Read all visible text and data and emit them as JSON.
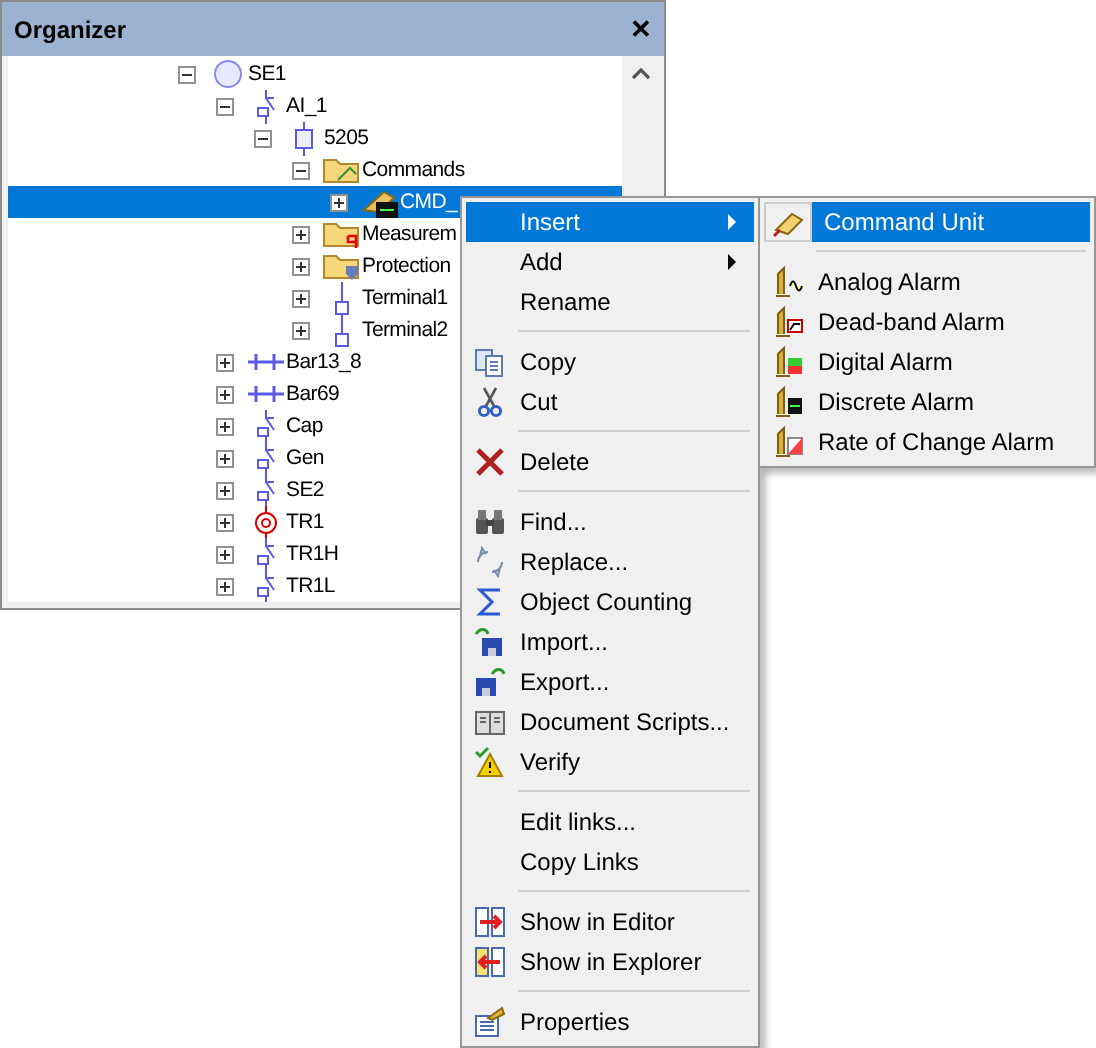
{
  "panel": {
    "title": "Organizer",
    "close": "✕"
  },
  "tree": [
    {
      "label": "SE1",
      "kind": "station",
      "expanded": true,
      "selected": false,
      "children": [
        {
          "label": "AI_1",
          "kind": "bay",
          "expanded": true,
          "selected": false,
          "children": [
            {
              "label": "5205",
              "kind": "node",
              "expanded": true,
              "selected": false,
              "children": [
                {
                  "label": "Commands",
                  "kind": "folder",
                  "expanded": true,
                  "selected": false,
                  "children": [
                    {
                      "label": "CMD_",
                      "kind": "command",
                      "expanded": false,
                      "selected": true
                    }
                  ]
                },
                {
                  "label": "Measurem",
                  "kind": "measure-folder",
                  "expanded": false,
                  "selected": false
                },
                {
                  "label": "Protection",
                  "kind": "protect-folder",
                  "expanded": false,
                  "selected": false
                },
                {
                  "label": "Terminal1",
                  "kind": "terminal",
                  "expanded": false,
                  "selected": false
                },
                {
                  "label": "Terminal2",
                  "kind": "terminal",
                  "expanded": false,
                  "selected": false
                }
              ]
            }
          ]
        },
        {
          "label": "Bar13_8",
          "kind": "busbar",
          "expanded": false,
          "selected": false
        },
        {
          "label": "Bar69",
          "kind": "busbar",
          "expanded": false,
          "selected": false
        },
        {
          "label": "Cap",
          "kind": "bay",
          "expanded": false,
          "selected": false
        },
        {
          "label": "Gen",
          "kind": "bay",
          "expanded": false,
          "selected": false
        },
        {
          "label": "SE2",
          "kind": "bay",
          "expanded": false,
          "selected": false
        },
        {
          "label": "TR1",
          "kind": "transformer",
          "expanded": false,
          "selected": false
        },
        {
          "label": "TR1H",
          "kind": "bay",
          "expanded": false,
          "selected": false
        },
        {
          "label": "TR1L",
          "kind": "bay",
          "expanded": false,
          "selected": false
        }
      ]
    }
  ],
  "context_menu": {
    "groups": [
      [
        {
          "label": "Insert",
          "kind": "plain",
          "submenu": true,
          "selected": true
        },
        {
          "label": "Add",
          "kind": "plain",
          "submenu": true,
          "selected": false
        },
        {
          "label": "Rename",
          "kind": "plain",
          "submenu": false,
          "selected": false
        }
      ],
      [
        {
          "label": "Copy",
          "kind": "copy",
          "submenu": false,
          "selected": false
        },
        {
          "label": "Cut",
          "kind": "cut",
          "submenu": false,
          "selected": false
        }
      ],
      [
        {
          "label": "Delete",
          "kind": "delete",
          "submenu": false,
          "selected": false
        }
      ],
      [
        {
          "label": "Find...",
          "kind": "find",
          "submenu": false,
          "selected": false
        },
        {
          "label": "Replace...",
          "kind": "replace",
          "submenu": false,
          "selected": false
        },
        {
          "label": "Object Counting",
          "kind": "sum",
          "submenu": false,
          "selected": false
        },
        {
          "label": "Import...",
          "kind": "import",
          "submenu": false,
          "selected": false
        },
        {
          "label": "Export...",
          "kind": "export",
          "submenu": false,
          "selected": false
        },
        {
          "label": "Document Scripts...",
          "kind": "book",
          "submenu": false,
          "selected": false
        },
        {
          "label": "Verify",
          "kind": "verify",
          "submenu": false,
          "selected": false
        }
      ],
      [
        {
          "label": "Edit links...",
          "kind": "plain",
          "submenu": false,
          "selected": false
        },
        {
          "label": "Copy Links",
          "kind": "plain",
          "submenu": false,
          "selected": false
        }
      ],
      [
        {
          "label": "Show in Editor",
          "kind": "show-editor",
          "submenu": false,
          "selected": false
        },
        {
          "label": "Show in Explorer",
          "kind": "show-explorer",
          "submenu": false,
          "selected": false
        }
      ],
      [
        {
          "label": "Properties",
          "kind": "properties",
          "submenu": false,
          "selected": false
        }
      ]
    ]
  },
  "submenu": {
    "groups": [
      [
        {
          "label": "Command Unit",
          "kind": "command",
          "selected": true
        }
      ],
      [
        {
          "label": "Analog Alarm",
          "kind": "analog",
          "selected": false
        },
        {
          "label": "Dead-band Alarm",
          "kind": "deadband",
          "selected": false
        },
        {
          "label": "Digital Alarm",
          "kind": "digital",
          "selected": false
        },
        {
          "label": "Discrete Alarm",
          "kind": "discrete",
          "selected": false
        },
        {
          "label": "Rate of Change Alarm",
          "kind": "rate",
          "selected": false
        }
      ]
    ]
  }
}
